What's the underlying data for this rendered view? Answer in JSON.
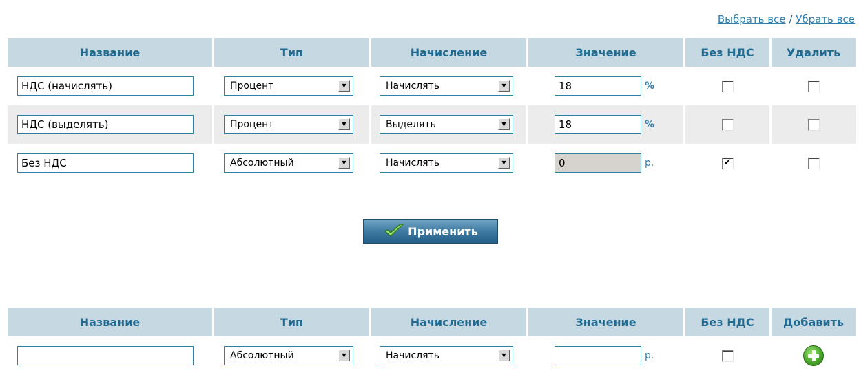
{
  "toolbar": {
    "select_all": "Выбрать все",
    "separator": "/",
    "deselect_all": "Убрать все"
  },
  "columns": {
    "name": "Название",
    "type": "Тип",
    "calc": "Начисление",
    "value": "Значение",
    "no_vat": "Без НДС",
    "delete": "Удалить",
    "add": "Добавить"
  },
  "rows": [
    {
      "name": "НДС (начислять)",
      "type": "Процент",
      "calc": "Начислять",
      "value": "18",
      "unit": "%",
      "no_vat_checked": false,
      "delete_checked": false
    },
    {
      "name": "НДС (выделять)",
      "type": "Процент",
      "calc": "Выделять",
      "value": "18",
      "unit": "%",
      "no_vat_checked": false,
      "delete_checked": false
    },
    {
      "name": "Без НДС",
      "type": "Абсолютный",
      "calc": "Начислять",
      "value": "0",
      "unit": "р.",
      "no_vat_checked": true,
      "delete_checked": false
    }
  ],
  "apply_button": {
    "label": "Применить"
  },
  "new_row": {
    "name": "",
    "type": "Абсолютный",
    "calc": "Начислять",
    "value": "",
    "unit": "р.",
    "no_vat_checked": false
  },
  "check_mark": "✔",
  "select_arrow": "▼",
  "colors": {
    "header_bg": "#c6d8e2",
    "header_text": "#1f6b92",
    "link": "#2f7fb0",
    "field_border": "#2f7fa0",
    "alt_row": "#ececec"
  }
}
